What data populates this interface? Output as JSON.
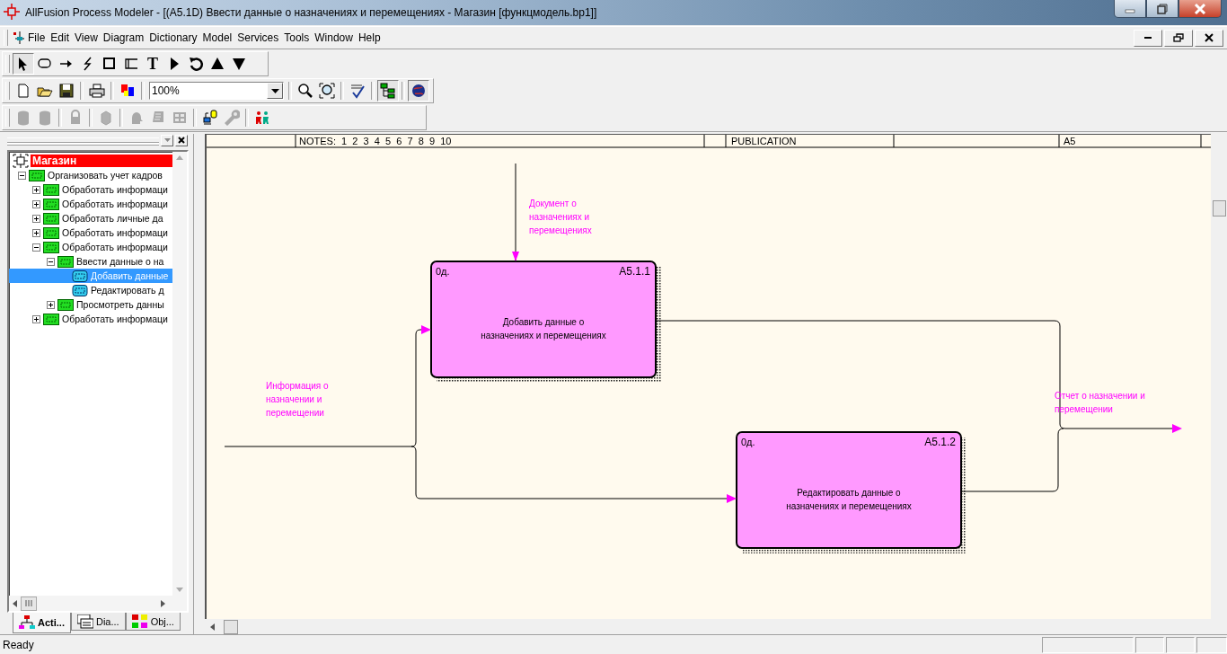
{
  "window": {
    "title": "AllFusion Process Modeler - [(A5.1D) Ввести данные о  назначениях и перемещениях - Магазин  [функцмодель.bp1]]"
  },
  "menu": [
    "File",
    "Edit",
    "View",
    "Diagram",
    "Dictionary",
    "Model",
    "Services",
    "Tools",
    "Window",
    "Help"
  ],
  "palette_tools": [
    {
      "kind": "pointer",
      "selected": true
    },
    {
      "kind": "box",
      "selected": false
    },
    {
      "kind": "arrow",
      "selected": false
    },
    {
      "kind": "squiggle",
      "selected": false
    },
    {
      "kind": "square",
      "selected": false
    },
    {
      "kind": "bracket",
      "selected": false
    },
    {
      "kind": "text",
      "glyph": "T",
      "selected": false
    },
    {
      "kind": "play",
      "selected": false
    },
    {
      "kind": "rotate",
      "selected": false
    },
    {
      "kind": "up",
      "selected": false
    },
    {
      "kind": "down",
      "selected": false
    }
  ],
  "standard_toolbar": {
    "zoom": "100%",
    "buttons": [
      {
        "kind": "new",
        "pressed": false
      },
      {
        "kind": "open",
        "pressed": false
      },
      {
        "kind": "save",
        "pressed": false
      },
      {
        "kind": "print",
        "pressed": false
      },
      {
        "kind": "color",
        "pressed": false
      },
      {
        "kind": "zoom_combo"
      },
      {
        "kind": "zoom",
        "pressed": false
      },
      {
        "kind": "zoom_fit",
        "pressed": false
      },
      {
        "kind": "spellcheck",
        "pressed": false
      },
      {
        "kind": "tree",
        "pressed": true
      },
      {
        "kind": "globe",
        "pressed": true
      }
    ]
  },
  "model_toolbar": [
    {
      "kind": "cylinder",
      "disabled": true
    },
    {
      "kind": "cylinder",
      "disabled": true
    },
    {
      "kind": "lock",
      "disabled": true
    },
    {
      "kind": "cube",
      "disabled": true
    },
    {
      "kind": "head",
      "disabled": true
    },
    {
      "kind": "scroll",
      "disabled": true
    },
    {
      "kind": "grid",
      "disabled": true
    },
    {
      "kind": "computer",
      "disabled": false
    },
    {
      "kind": "wrench",
      "disabled": true
    },
    {
      "kind": "people",
      "disabled": false
    }
  ],
  "tree": {
    "label": "Магазин",
    "children": [
      {
        "label": "Организовать учет кадров",
        "expanded": true,
        "selected": false,
        "children": [
          {
            "label": "Обработать информаци",
            "expanded": false,
            "selected": false
          },
          {
            "label": "Обработать информаци",
            "expanded": false,
            "selected": false
          },
          {
            "label": "Обработать личные  да",
            "expanded": false,
            "selected": false
          },
          {
            "label": "Обработать информаци",
            "expanded": false,
            "selected": false
          },
          {
            "label": "Обработать информаци",
            "expanded": true,
            "selected": false,
            "children": [
              {
                "label": "Ввести данные о  на",
                "expanded": true,
                "selected": false,
                "children": [
                  {
                    "label": "Добавить данные",
                    "selected": true
                  },
                  {
                    "label": "Редактировать д",
                    "selected": false
                  }
                ]
              },
              {
                "label": "Просмотреть данны",
                "expanded": false,
                "selected": false
              }
            ]
          },
          {
            "label": "Обработать информаци",
            "expanded": false,
            "selected": false
          }
        ]
      }
    ]
  },
  "panel_tabs": [
    {
      "label": "Acti...",
      "kind": "activities",
      "selected": true
    },
    {
      "label": "Dia...",
      "kind": "diagrams",
      "selected": false
    },
    {
      "label": "Obj...",
      "kind": "objects",
      "selected": false
    }
  ],
  "diagram": {
    "frame_header": [
      "NOTES:  1  2  3  4  5  6  7  8  9  10",
      "PUBLICATION",
      "A5"
    ],
    "boxes": [
      {
        "cost": "0д.",
        "number": "A5.1.1",
        "name": [
          "Добавить данные о",
          "назначениях и перемещениях"
        ]
      },
      {
        "cost": "0д.",
        "number": "A5.1.2",
        "name": [
          "Редактировать данные о",
          "назначениях и перемещениях"
        ]
      }
    ],
    "arrows": [
      {
        "kind": "control",
        "label": [
          "Документ о",
          "назначениях и",
          "перемещениях"
        ]
      },
      {
        "kind": "input",
        "label": [
          "Информация о",
          "назначении и",
          "перемещении"
        ]
      },
      {
        "kind": "output",
        "label": [
          "Отчет о назначении и",
          "перемещении"
        ]
      }
    ]
  },
  "status_bar": {
    "text": "Ready"
  }
}
